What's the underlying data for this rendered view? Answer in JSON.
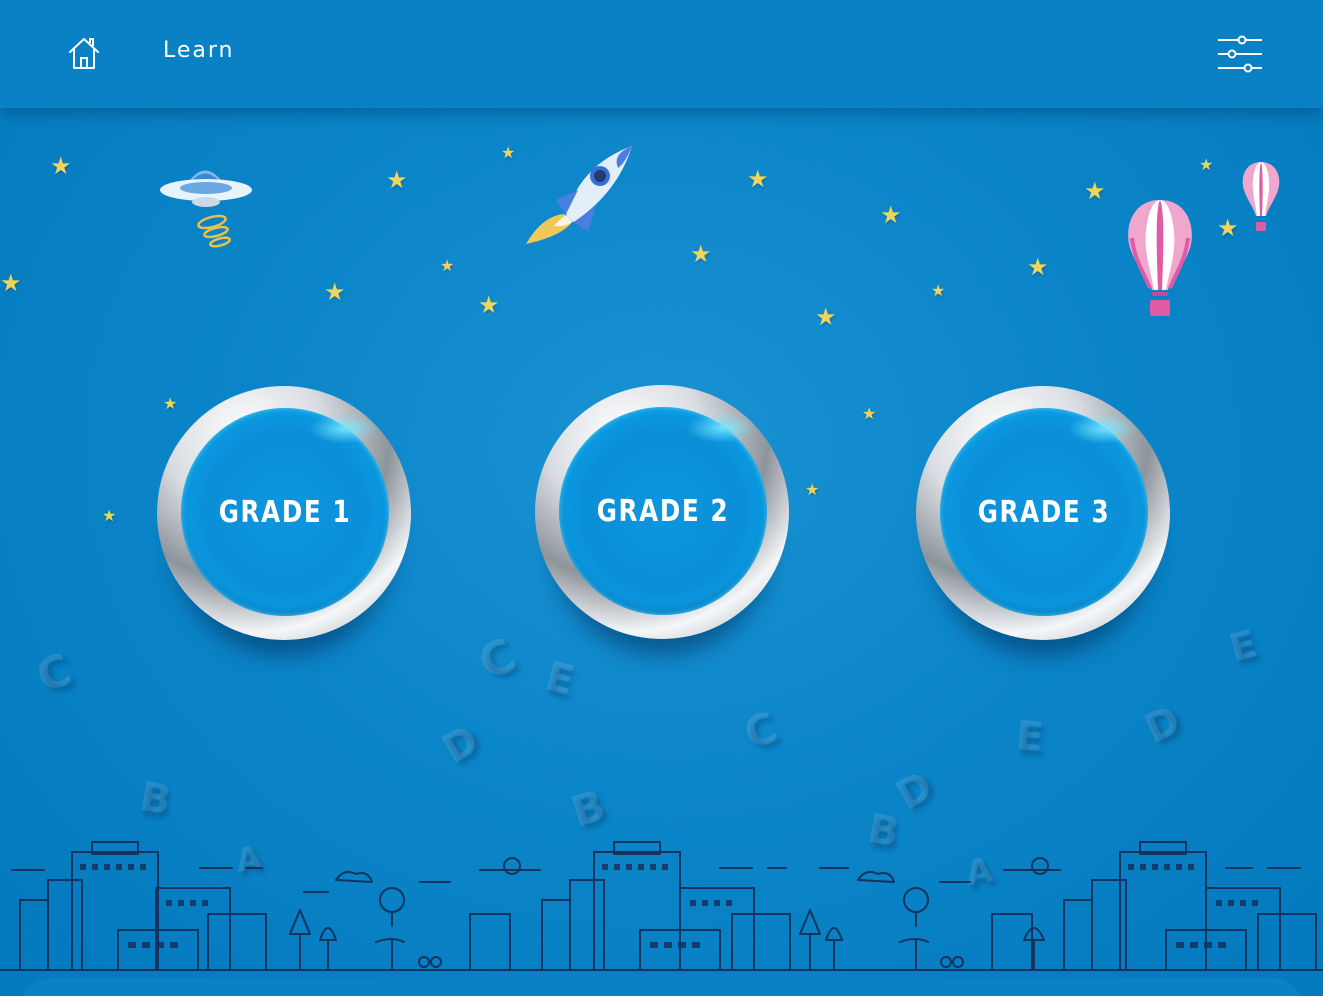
{
  "header": {
    "title": "Learn",
    "home_icon": "home-icon",
    "settings_icon": "sliders-icon"
  },
  "grades": [
    {
      "label": "GRADE 1"
    },
    {
      "label": "GRADE 2"
    },
    {
      "label": "GRADE 3"
    }
  ],
  "colors": {
    "background": "#0b85c9",
    "header": "#0a80c5",
    "star": "#f0d45c",
    "button_inner": "#0d96de",
    "text": "#ffffff"
  },
  "decorations": {
    "ufo": "ufo-illustration",
    "rocket": "rocket-illustration",
    "balloons": "hot-air-balloon-illustration",
    "skyline": "city-skyline-illustration",
    "floating_letters": "alphabet-letters"
  }
}
